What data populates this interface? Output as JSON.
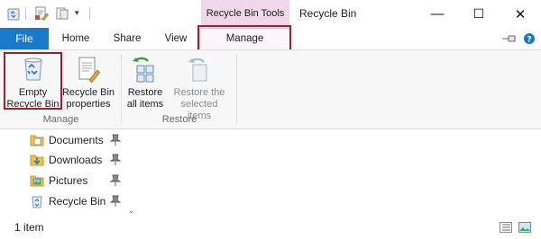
{
  "window": {
    "title": "Recycle Bin",
    "context_tab_title": "Recycle Bin Tools",
    "controls": {
      "minimize": "—",
      "maximize": "☐",
      "close": "✕"
    }
  },
  "tabs": [
    {
      "label": "File"
    },
    {
      "label": "Home"
    },
    {
      "label": "Share"
    },
    {
      "label": "View"
    },
    {
      "label": "Manage"
    }
  ],
  "ribbon": {
    "manage_group": {
      "label": "Manage",
      "buttons": [
        {
          "line1": "Empty",
          "line2": "Recycle Bin",
          "icon": "recycle-bin-icon"
        },
        {
          "line1": "Recycle Bin",
          "line2": "properties",
          "icon": "properties-icon"
        }
      ]
    },
    "restore_group": {
      "label": "Restore",
      "buttons": [
        {
          "line1": "Restore",
          "line2": "all items",
          "icon": "restore-all-icon"
        },
        {
          "line1": "Restore the",
          "line2": "selected items",
          "icon": "restore-selected-icon"
        }
      ]
    }
  },
  "nav_pane": {
    "items": [
      {
        "label": "Documents",
        "icon": "documents-icon",
        "pinned": true
      },
      {
        "label": "Downloads",
        "icon": "downloads-icon",
        "pinned": true
      },
      {
        "label": "Pictures",
        "icon": "pictures-icon",
        "pinned": true
      },
      {
        "label": "Recycle Bin",
        "icon": "recycle-bin-icon",
        "pinned": true
      }
    ]
  },
  "status_bar": {
    "item_count": "1 item"
  },
  "colors": {
    "file_tab": "#1979ca",
    "context_band": "#f1d7ec",
    "highlight_border": "#a0202a",
    "ribbon_bg": "#f7f7f7"
  }
}
